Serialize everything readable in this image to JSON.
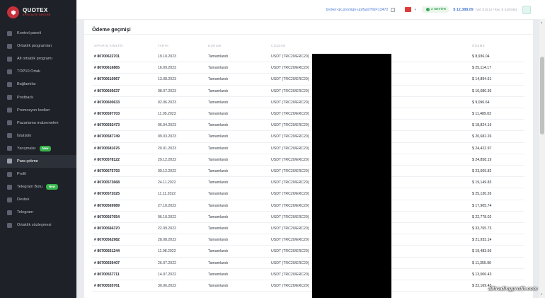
{
  "logo": {
    "title": "QUOTEX",
    "subtitle": "AFFILIATE CENTER"
  },
  "sidebar": {
    "items": [
      {
        "label": "Kontrol paneli"
      },
      {
        "label": "Ortaklık programları"
      },
      {
        "label": "Alt ortaklık programı"
      },
      {
        "label": "TOP10 Ortak"
      },
      {
        "label": "Bağlantılar"
      },
      {
        "label": "Postback"
      },
      {
        "label": "Promosyon kodları"
      },
      {
        "label": "Pazarlama malzemeleri"
      },
      {
        "label": "İstatistik"
      },
      {
        "label": "Yarışmalar",
        "badge": "New"
      },
      {
        "label": "Para çekme",
        "active": true
      },
      {
        "label": "Profil"
      },
      {
        "label": "Telegram Botu",
        "badge": "New"
      },
      {
        "label": "Destek"
      },
      {
        "label": "Telegram"
      },
      {
        "label": "Ortaklık sözleşmesi"
      }
    ]
  },
  "header": {
    "link": "broker-qx.pro/sign-up/fast/?lid=13472",
    "level": "2 SEVİYE",
    "balance": "$ 12,388.09",
    "balance_sub": "(Vol: $ 19.12 / Rev: $ -1200.85)"
  },
  "page": {
    "title": "Ödeme geçmişi",
    "columns": [
      "SİPARİŞ KİMLİĞİ",
      "TARİH",
      "DURUM",
      "CÜZDAN",
      "ÖDEME"
    ]
  },
  "payments": [
    {
      "id": "# 80700622701",
      "date": "19.10.2023",
      "status": "Tamamlandı",
      "wallet": "USDT (TRC20/ERC20)",
      "amount": "$ 8,936.04"
    },
    {
      "id": "# 80700616865",
      "date": "16.09.2023",
      "status": "Tamamlandı",
      "wallet": "USDT (TRC20/ERC20)",
      "amount": "$ 25,114.17"
    },
    {
      "id": "# 80700610967",
      "date": "13.08.2023",
      "status": "Tamamlandı",
      "wallet": "USDT (TRC20/ERC20)",
      "amount": "$ 14,894.61"
    },
    {
      "id": "# 80700605637",
      "date": "08.07.2023",
      "status": "Tamamlandı",
      "wallet": "USDT (TRC20/ERC20)",
      "amount": "$ 16,080.36"
    },
    {
      "id": "# 80700600633",
      "date": "02.06.2023",
      "status": "Tamamlandı",
      "wallet": "USDT (TRC20/ERC20)",
      "amount": "$ 9,096.64"
    },
    {
      "id": "# 80700597703",
      "date": "11.05.2023",
      "status": "Tamamlandı",
      "wallet": "USDT (TRC20/ERC20)",
      "amount": "$ 11,489.03"
    },
    {
      "id": "# 80700592473",
      "date": "06.04.2023",
      "status": "Tamamlandı",
      "wallet": "USDT (TRC20/ERC20)",
      "amount": "$ 18,824.16"
    },
    {
      "id": "# 80700587749",
      "date": "09.03.2023",
      "status": "Tamamlandı",
      "wallet": "USDT (TRC20/ERC20)",
      "amount": "$ 20,682.26"
    },
    {
      "id": "# 80700581676",
      "date": "20.01.2023",
      "status": "Tamamlandı",
      "wallet": "USDT (TRC20/ERC20)",
      "amount": "$ 24,422.97"
    },
    {
      "id": "# 80700578122",
      "date": "29.12.2022",
      "status": "Tamamlandı",
      "wallet": "USDT (TRC20/ERC20)",
      "amount": "$ 24,858.19"
    },
    {
      "id": "# 80700575793",
      "date": "09.12.2022",
      "status": "Tamamlandı",
      "wallet": "USDT (TRC20/ERC20)",
      "amount": "$ 23,609.82"
    },
    {
      "id": "# 80700573668",
      "date": "24.11.2022",
      "status": "Tamamlandı",
      "wallet": "USDT (TRC20/ERC20)",
      "amount": "$ 19,149.83"
    },
    {
      "id": "# 80700572025",
      "date": "11.11.2022",
      "status": "Tamamlandı",
      "wallet": "USDT (TRC20/ERC20)",
      "amount": "$ 25,130.26"
    },
    {
      "id": "# 80700569989",
      "date": "27.10.2022",
      "status": "Tamamlandı",
      "wallet": "USDT (TRC20/ERC20)",
      "amount": "$ 17,905.74"
    },
    {
      "id": "# 80700567654",
      "date": "06.10.2022",
      "status": "Tamamlandı",
      "wallet": "USDT (TRC20/ERC20)",
      "amount": "$ 22,778.02"
    },
    {
      "id": "# 80700566370",
      "date": "22.09.2022",
      "status": "Tamamlandı",
      "wallet": "USDT (TRC20/ERC20)",
      "amount": "$ 33,765.73"
    },
    {
      "id": "# 80700562982",
      "date": "28.08.2022",
      "status": "Tamamlandı",
      "wallet": "USDT (TRC20/ERC20)",
      "amount": "$ 21,933.14"
    },
    {
      "id": "# 80700561244",
      "date": "11.08.2022",
      "status": "Tamamlandı",
      "wallet": "USDT (TRC20/ERC20)",
      "amount": "$ 19,483.66"
    },
    {
      "id": "# 80700559407",
      "date": "26.07.2022",
      "status": "Tamamlandı",
      "wallet": "USDT (TRC20/ERC20)",
      "amount": "$ 11,355.90"
    },
    {
      "id": "# 80700557711",
      "date": "14.07.2022",
      "status": "Tamamlandı",
      "wallet": "USDT (TRC20/ERC20)",
      "amount": "$ 13,006.43"
    },
    {
      "id": "# 80700555761",
      "date": "30.06.2022",
      "status": "Tamamlandı",
      "wallet": "USDT (TRC20/ERC20)",
      "amount": "$ 22,169.43"
    }
  ],
  "watermark": "alltradingprofit.com"
}
